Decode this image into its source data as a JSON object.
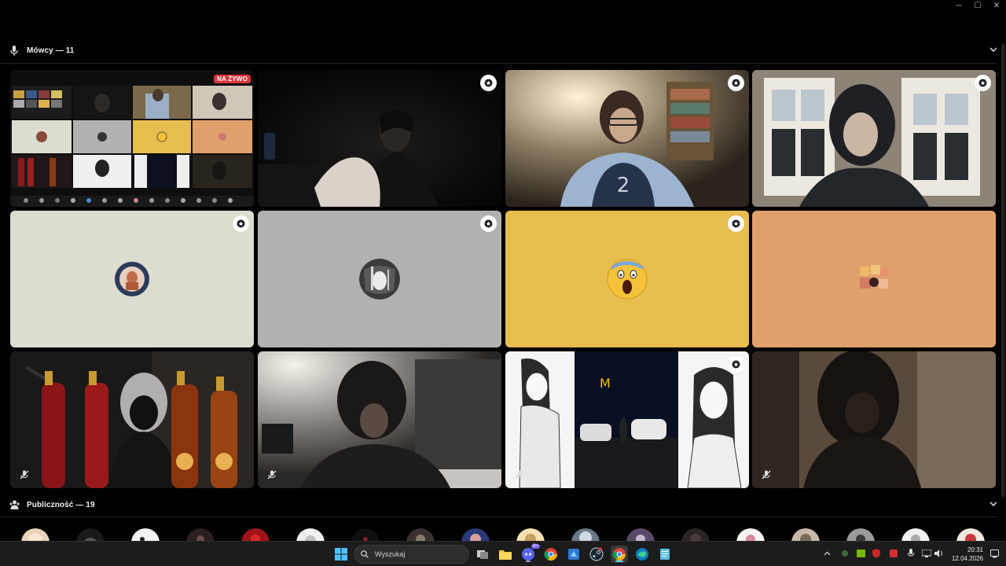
{
  "window": {
    "minimize": "─",
    "maximize": "☐",
    "close": "✕"
  },
  "speakers": {
    "title": "Mówcy — 11"
  },
  "audience": {
    "title": "Publiczność — 19"
  },
  "stream_tile": {
    "live_label": "NA ŻYWO"
  },
  "tiles": [
    {
      "kind": "screen-share",
      "live": true
    },
    {
      "kind": "video",
      "host": true
    },
    {
      "kind": "video",
      "host": true
    },
    {
      "kind": "video",
      "host": true
    },
    {
      "kind": "avatar",
      "bg": "#dcdcd0",
      "host": true
    },
    {
      "kind": "avatar",
      "bg": "#b3b0b1",
      "host": true
    },
    {
      "kind": "avatar",
      "bg": "#e8bd4f",
      "host": true
    },
    {
      "kind": "avatar",
      "bg": "#e0a06c",
      "host": false
    },
    {
      "kind": "video",
      "muted": true
    },
    {
      "kind": "video",
      "muted": true
    },
    {
      "kind": "video",
      "muted": true,
      "host": true
    },
    {
      "kind": "video",
      "muted": true
    }
  ],
  "taskbar": {
    "search_placeholder": "Wyszukaj",
    "time": "20:31",
    "date": "12.04.2026",
    "notification_badge": "9+",
    "icons": [
      "windows-start-icon",
      "search-icon",
      "task-view-icon",
      "file-explorer-icon",
      "discord-icon",
      "chrome-icon",
      "store-icon",
      "steam-icon",
      "chrome-icon",
      "edge-icon",
      "notepad-icon"
    ]
  },
  "colors": {
    "background": "#000000",
    "accent_live": "#da373c",
    "tile_beige": "#dcdcd0",
    "tile_gray": "#b3b0b1",
    "tile_yellow": "#e8bd4f",
    "tile_orange": "#e0a06c"
  }
}
